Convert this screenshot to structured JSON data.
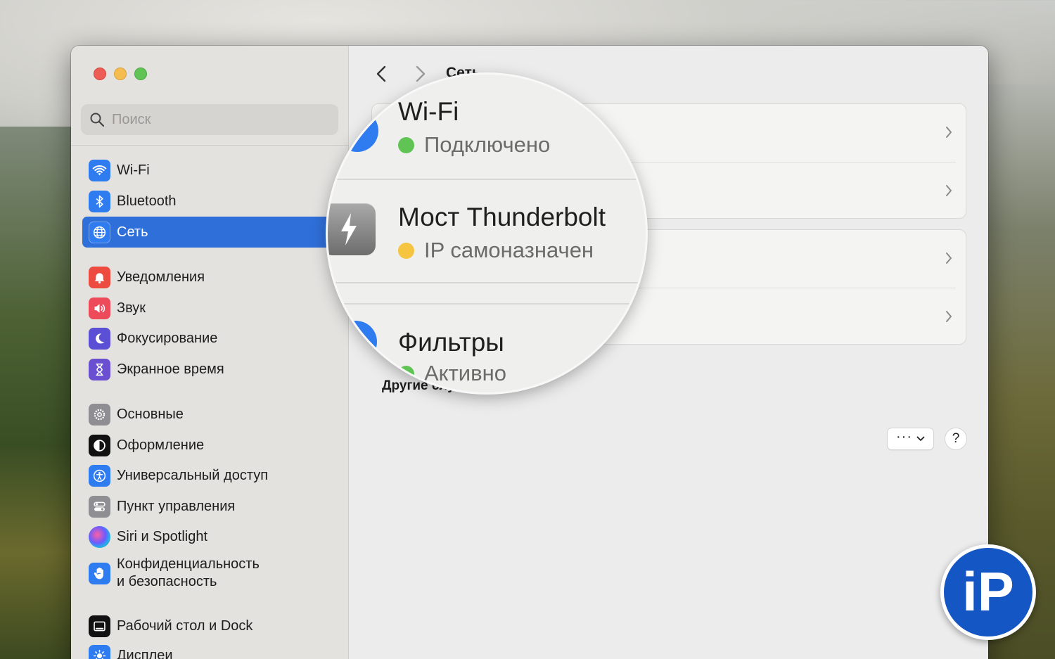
{
  "window": {
    "search": {
      "placeholder": "Поиск"
    },
    "sidebar": {
      "items": [
        {
          "label": "Wi-Fi",
          "icon": "wifi-icon",
          "color": "#2f7bf0"
        },
        {
          "label": "Bluetooth",
          "icon": "bluetooth-icon",
          "color": "#2f7bf0"
        },
        {
          "label": "Сеть",
          "icon": "globe-icon",
          "color": "#2f7bf0",
          "active": true
        },
        {
          "label": "Уведомления",
          "icon": "bell-icon",
          "color": "#ee4b40"
        },
        {
          "label": "Звук",
          "icon": "speaker-icon",
          "color": "#ee4b5a"
        },
        {
          "label": "Фокусирование",
          "icon": "moon-icon",
          "color": "#5b4fd6"
        },
        {
          "label": "Экранное время",
          "icon": "hourglass-icon",
          "color": "#6a4fd0"
        },
        {
          "label": "Основные",
          "icon": "gear-icon",
          "color": "#8e8e93"
        },
        {
          "label": "Оформление",
          "icon": "appearance-icon",
          "color": "#111111"
        },
        {
          "label": "Универсальный доступ",
          "icon": "accessibility-icon",
          "color": "#2f7bf0"
        },
        {
          "label": "Пункт управления",
          "icon": "control-center-icon",
          "color": "#8e8e93"
        },
        {
          "label": "Siri и Spotlight",
          "icon": "siri-icon",
          "color": "#222222"
        },
        {
          "label_line1": "Конфиденциальность",
          "label_line2": "и безопасность",
          "icon": "hand-icon",
          "color": "#2f7bf0"
        },
        {
          "label": "Рабочий стол и Dock",
          "icon": "dock-icon",
          "color": "#111111"
        },
        {
          "label": "Дисплеи",
          "icon": "sun-icon",
          "color": "#2f7bf0"
        }
      ]
    },
    "main": {
      "title": "Сеть",
      "other_services_label": "Другие слу",
      "more_button_dots": "···",
      "help_button": "?"
    },
    "magnifier": {
      "wifi_title": "Wi-Fi",
      "wifi_status": "Подключено",
      "thunderbolt_title": "Мост Thunderbolt",
      "thunderbolt_status": "IP самоназначен",
      "filters_title": "Фильтры",
      "filters_status": "Активно"
    },
    "colors": {
      "accent": "#2f6fd9",
      "status_connected": "#5fc454",
      "status_self_assigned": "#f5c542"
    }
  },
  "watermark": {
    "logo_text": "iP"
  }
}
